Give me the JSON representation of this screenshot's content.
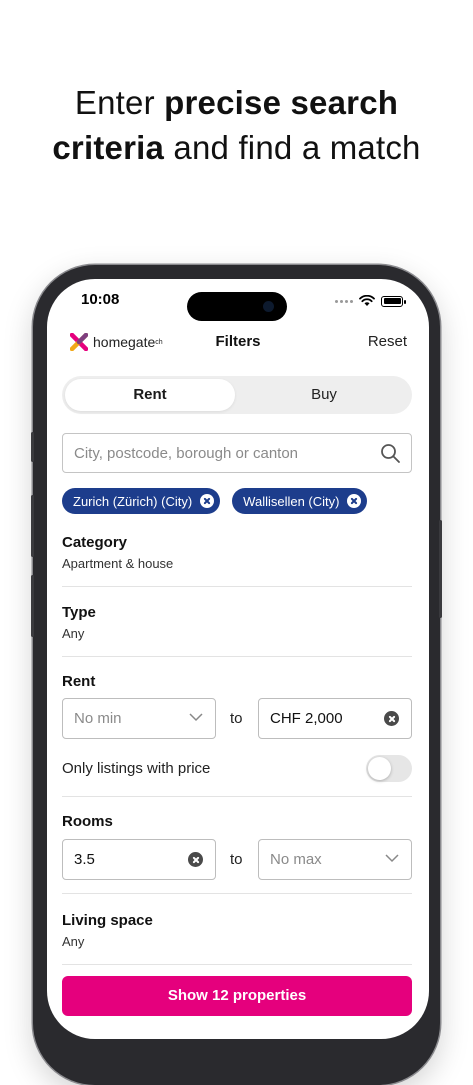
{
  "headline": {
    "normal1": "Enter ",
    "bold1": "precise search",
    "bold2": "criteria",
    "normal2": " and find a match"
  },
  "status": {
    "time": "10:08"
  },
  "header": {
    "logo_text": "homegate",
    "logo_suffix": "ch",
    "title": "Filters",
    "reset": "Reset"
  },
  "toggle": {
    "active": "Rent",
    "inactive": "Buy"
  },
  "search": {
    "placeholder": "City, postcode, borough or canton"
  },
  "chips": [
    "Zurich (Zürich) (City)",
    "Wallisellen (City)"
  ],
  "category": {
    "title": "Category",
    "value": "Apartment & house"
  },
  "type": {
    "title": "Type",
    "value": "Any"
  },
  "rent": {
    "title": "Rent",
    "min_placeholder": "No min",
    "to": "to",
    "max_value": "CHF 2,000",
    "only_with_price": "Only listings with price",
    "only_with_price_on": false
  },
  "rooms": {
    "title": "Rooms",
    "min_value": "3.5",
    "to": "to",
    "max_placeholder": "No max"
  },
  "living_space": {
    "title": "Living space",
    "value": "Any"
  },
  "cta": {
    "label": "Show 12 properties"
  },
  "colors": {
    "brand": "#e5007d",
    "chip": "#1d3d8c"
  }
}
